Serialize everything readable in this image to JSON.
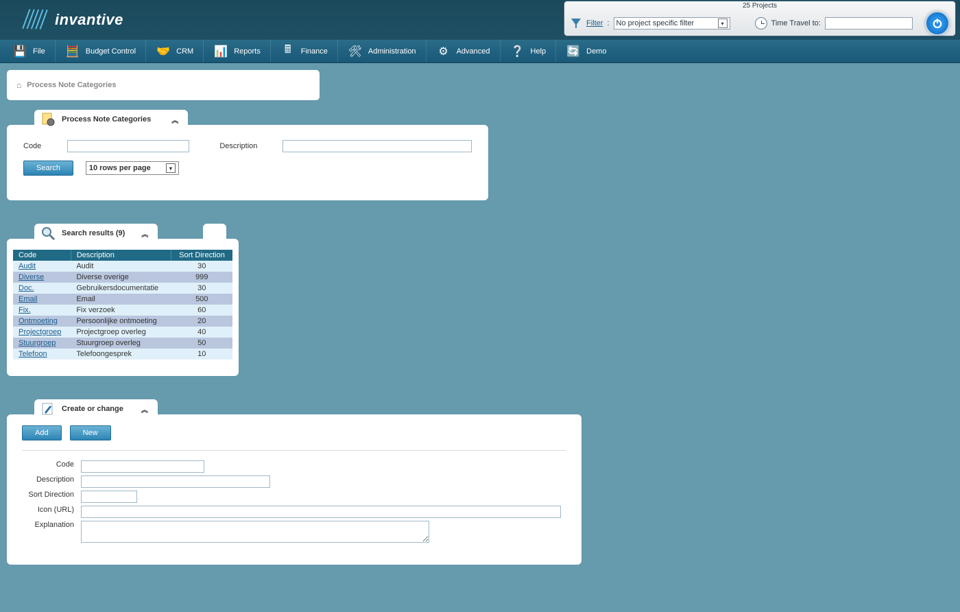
{
  "brand": "invantive",
  "top_panel": {
    "projects_count": "25 Projects",
    "filter_label": "Filter",
    "filter_colon": " : ",
    "project_select": "No project specific filter",
    "time_travel_label": "Time Travel to:"
  },
  "menu": {
    "file": "File",
    "budget": "Budget Control",
    "crm": "CRM",
    "reports": "Reports",
    "finance": "Finance",
    "admin": "Administration",
    "advanced": "Advanced",
    "help": "Help",
    "demo": "Demo"
  },
  "breadcrumb": {
    "title": "Process Note Categories"
  },
  "search_panel": {
    "title": "Process Note Categories",
    "code_label": "Code",
    "desc_label": "Description",
    "search_btn": "Search",
    "rows_per_page": "10 rows per page"
  },
  "results_panel": {
    "title": "Search results (9)",
    "headers": {
      "code": "Code",
      "description": "Description",
      "sort": "Sort Direction"
    },
    "rows": [
      {
        "code": "Audit",
        "description": "Audit",
        "sort": "30"
      },
      {
        "code": "Diverse",
        "description": "Diverse overige",
        "sort": "999"
      },
      {
        "code": "Doc.",
        "description": "Gebruikersdocumentatie",
        "sort": "30"
      },
      {
        "code": "Email",
        "description": "Email",
        "sort": "500"
      },
      {
        "code": "Fix.",
        "description": "Fix verzoek",
        "sort": "60"
      },
      {
        "code": "Ontmoeting",
        "description": "Persoonlijke ontmoeting",
        "sort": "20"
      },
      {
        "code": "Projectgroep",
        "description": "Projectgroep overleg",
        "sort": "40"
      },
      {
        "code": "Stuurgroep",
        "description": "Stuurgroep overleg",
        "sort": "50"
      },
      {
        "code": "Telefoon",
        "description": "Telefoongesprek",
        "sort": "10"
      }
    ]
  },
  "create_panel": {
    "title": "Create or change",
    "add_btn": "Add",
    "new_btn": "New",
    "fields": {
      "code": "Code",
      "description": "Description",
      "sort": "Sort Direction",
      "icon_url": "Icon (URL)",
      "explanation": "Explanation"
    }
  }
}
